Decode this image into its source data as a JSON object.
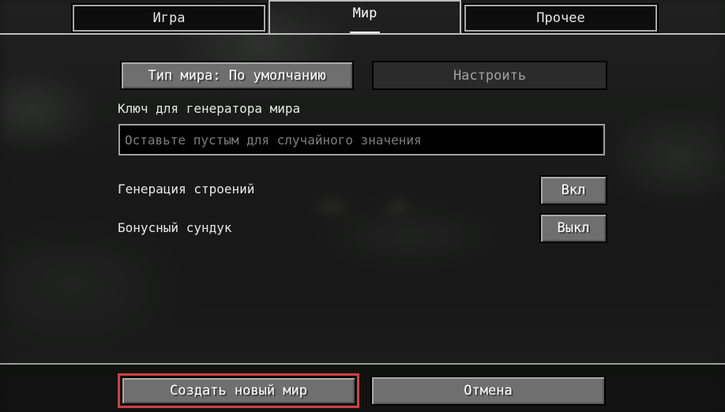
{
  "tabs": [
    {
      "label": "Игра",
      "selected": false
    },
    {
      "label": "Мир",
      "selected": true
    },
    {
      "label": "Прочее",
      "selected": false
    }
  ],
  "world": {
    "world_type_button": "Тип мира: По умолчанию",
    "customize_button": "Настроить",
    "seed_label": "Ключ для генератора мира",
    "seed_input": {
      "value": "",
      "placeholder": "Оставьте пустым для случайного значения"
    },
    "structures_label": "Генерация строений",
    "structures_toggle": "Вкл",
    "bonus_chest_label": "Бонусный сундук",
    "bonus_chest_toggle": "Выкл"
  },
  "footer": {
    "create_button": "Создать новый мир",
    "cancel_button": "Отмена"
  },
  "colors": {
    "focus_outline": "#d04040",
    "button_face": "#6f6f6f",
    "disabled_button": "#2b2b2b"
  }
}
